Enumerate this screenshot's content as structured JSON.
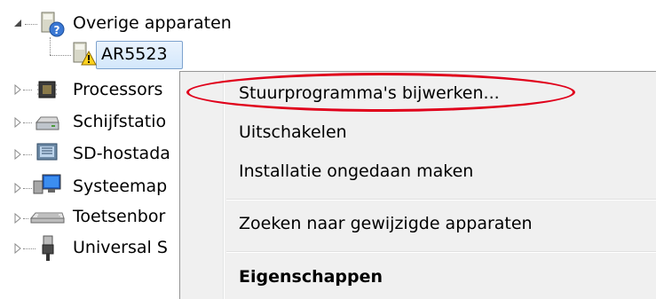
{
  "tree": {
    "group": {
      "label": "Overige apparaten",
      "icon": "unknown-device-icon"
    },
    "child": {
      "label": "AR5523",
      "icon": "warning-device-icon"
    },
    "nodes": [
      {
        "label": "Processors",
        "icon": "processor-icon"
      },
      {
        "label": "Schijfstatio",
        "icon": "disk-drive-icon"
      },
      {
        "label": "SD-hostada",
        "icon": "sd-host-icon"
      },
      {
        "label": "Systeemap",
        "icon": "system-device-icon"
      },
      {
        "label": "Toetsenbor",
        "icon": "keyboard-icon"
      },
      {
        "label": "Universal S",
        "icon": "usb-icon"
      }
    ]
  },
  "menu": {
    "items": [
      {
        "label": "Stuurprogramma's bijwerken..."
      },
      {
        "label": "Uitschakelen"
      },
      {
        "label": "Installatie ongedaan maken"
      },
      {
        "label": "Zoeken naar gewijzigde apparaten"
      },
      {
        "label": "Eigenschappen"
      }
    ]
  },
  "colors": {
    "highlight_ellipse": "#e0001b",
    "menu_bg": "#f0f0f0",
    "selection": "#d3e7fb"
  }
}
